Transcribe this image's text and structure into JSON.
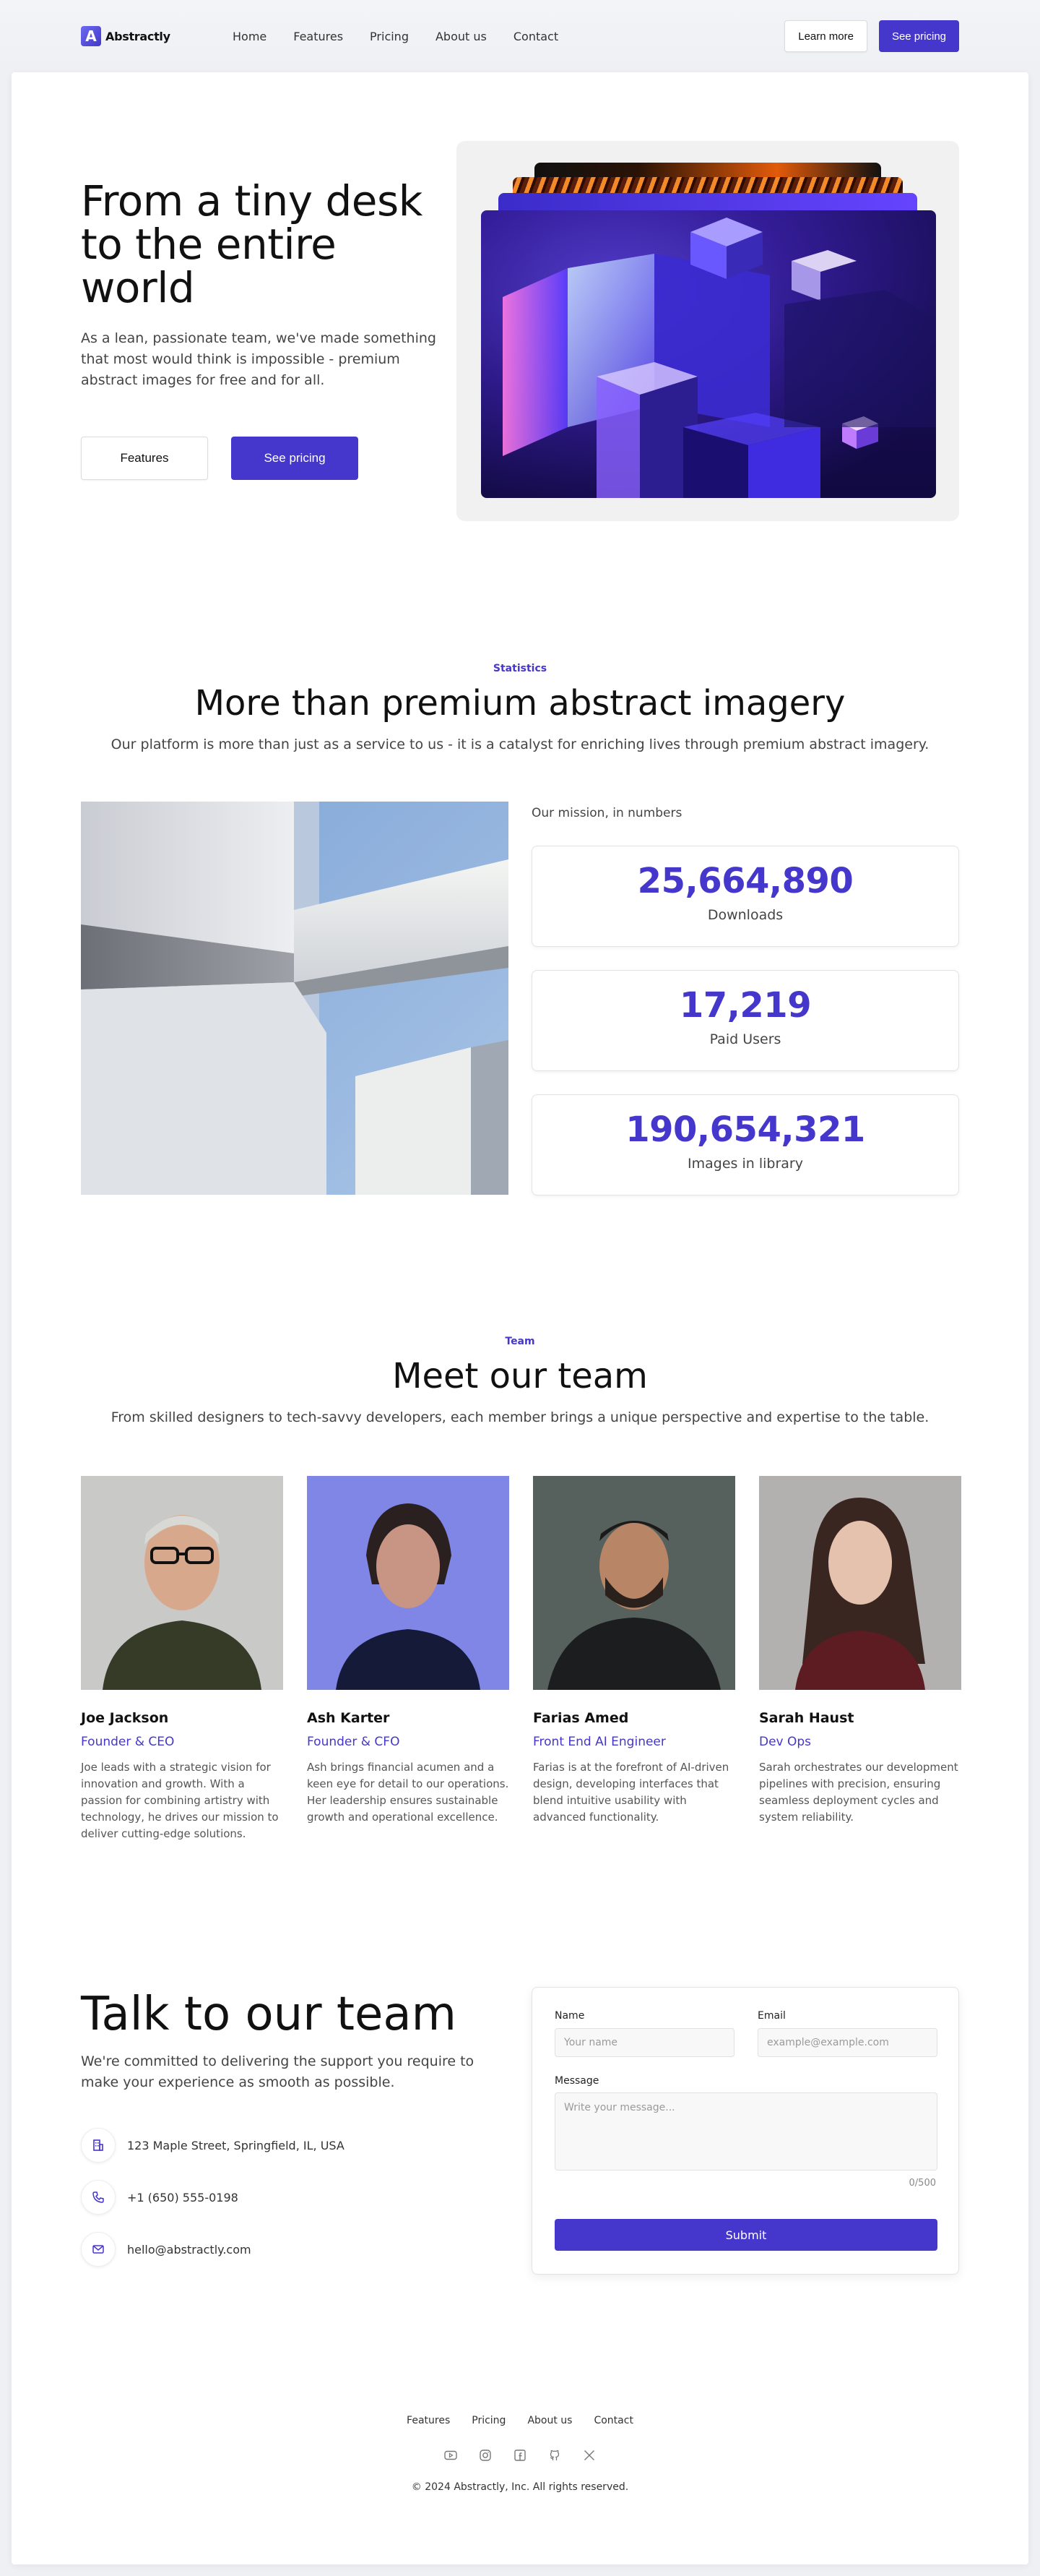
{
  "brand": {
    "name": "Abstractly",
    "logo_letter": "A",
    "accent": "#4536cc"
  },
  "nav": {
    "links": [
      "Home",
      "Features",
      "Pricing",
      "About us",
      "Contact"
    ],
    "learn_more": "Learn more",
    "see_pricing": "See pricing"
  },
  "hero": {
    "title": "From a tiny desk to the entire world",
    "subtitle": "As a lean, passionate team, we've made something that most would think is impossible - premium abstract images for free and for all.",
    "features_button": "Features",
    "pricing_button": "See pricing"
  },
  "stats": {
    "eyebrow": "Statistics",
    "title": "More than premium abstract imagery",
    "subtitle": "Our platform is more than just as a service to us - it is a catalyst for enriching lives through premium abstract imagery.",
    "mission_label": "Our mission, in numbers",
    "items": [
      {
        "value": "25,664,890",
        "label": "Downloads"
      },
      {
        "value": "17,219",
        "label": "Paid Users"
      },
      {
        "value": "190,654,321",
        "label": "Images in library"
      }
    ]
  },
  "team": {
    "eyebrow": "Team",
    "title": "Meet our team",
    "subtitle": "From skilled designers to tech-savvy developers, each member brings a unique perspective and expertise to the table.",
    "members": [
      {
        "name": "Joe Jackson",
        "role": "Founder & CEO",
        "bio": "Joe leads with a strategic vision for innovation and growth. With a passion for combining artistry with technology, he drives our mission to deliver cutting-edge solutions."
      },
      {
        "name": "Ash Karter",
        "role": "Founder & CFO",
        "bio": "Ash brings financial acumen and a keen eye for detail to our operations. Her leadership ensures sustainable growth and operational excellence."
      },
      {
        "name": "Farias Amed",
        "role": "Front End AI Engineer",
        "bio": "Farias is at the forefront of AI-driven design, developing interfaces that blend intuitive usability with advanced functionality."
      },
      {
        "name": "Sarah Haust",
        "role": "Dev Ops",
        "bio": "Sarah orchestrates our development pipelines with precision, ensuring seamless deployment cycles and system reliability."
      }
    ]
  },
  "contact": {
    "title": "Talk to our team",
    "subtitle": "We're committed to delivering the support you require to make your experience as smooth as possible.",
    "address": "123 Maple Street, Springfield, IL, USA",
    "phone": "+1 (650) 555-0198",
    "email": "hello@abstractly.com",
    "form": {
      "name_label": "Name",
      "name_placeholder": "Your name",
      "email_label": "Email",
      "email_placeholder": "example@example.com",
      "message_label": "Message",
      "message_placeholder": "Write your message...",
      "counter": "0/500",
      "submit": "Submit"
    }
  },
  "footer": {
    "links": [
      "Features",
      "Pricing",
      "About us",
      "Contact"
    ],
    "social_icons": [
      "youtube-icon",
      "instagram-icon",
      "facebook-icon",
      "github-icon",
      "x-icon"
    ],
    "copyright": "© 2024 Abstractly, Inc. All rights reserved."
  }
}
